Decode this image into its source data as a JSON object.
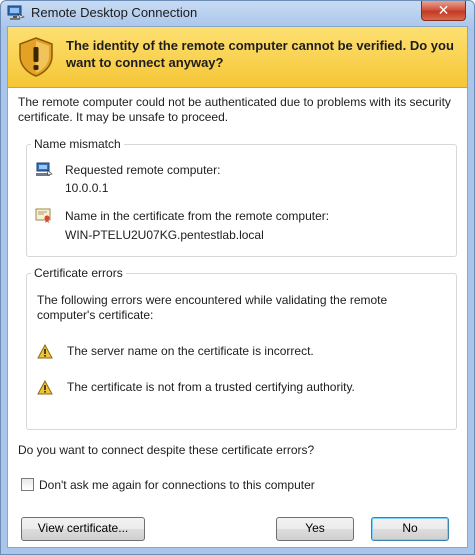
{
  "window": {
    "title": "Remote Desktop Connection"
  },
  "banner": {
    "text": "The identity of the remote computer cannot be verified. Do you want to connect anyway?"
  },
  "description": "The remote computer could not be authenticated due to problems with its security certificate. It may be unsafe to proceed.",
  "name_mismatch": {
    "heading": "Name mismatch",
    "requested_label": "Requested remote computer:",
    "requested_value": "10.0.0.1",
    "certificate_label": "Name in the certificate from the remote computer:",
    "certificate_value": "WIN-PTELU2U07KG.pentestlab.local"
  },
  "certificate_errors": {
    "heading": "Certificate errors",
    "intro": "The following errors were encountered while validating the remote computer's certificate:",
    "items": [
      "The server name on the certificate is incorrect.",
      "The certificate is not from a trusted certifying authority."
    ]
  },
  "question": "Do you want to connect despite these certificate errors?",
  "checkbox": {
    "label": "Don't ask me again for connections to this computer",
    "checked": false
  },
  "buttons": {
    "view_certificate": "View certificate...",
    "yes": "Yes",
    "no": "No"
  },
  "icons": {
    "title": "remote-desktop-icon",
    "banner": "security-shield-warning-icon",
    "requested": "computer-icon",
    "certificate": "certificate-icon",
    "errors": "warning-icon"
  },
  "colors": {
    "banner": "#f9d44f",
    "close": "#c9432c",
    "frame": "#a9c5ea"
  }
}
